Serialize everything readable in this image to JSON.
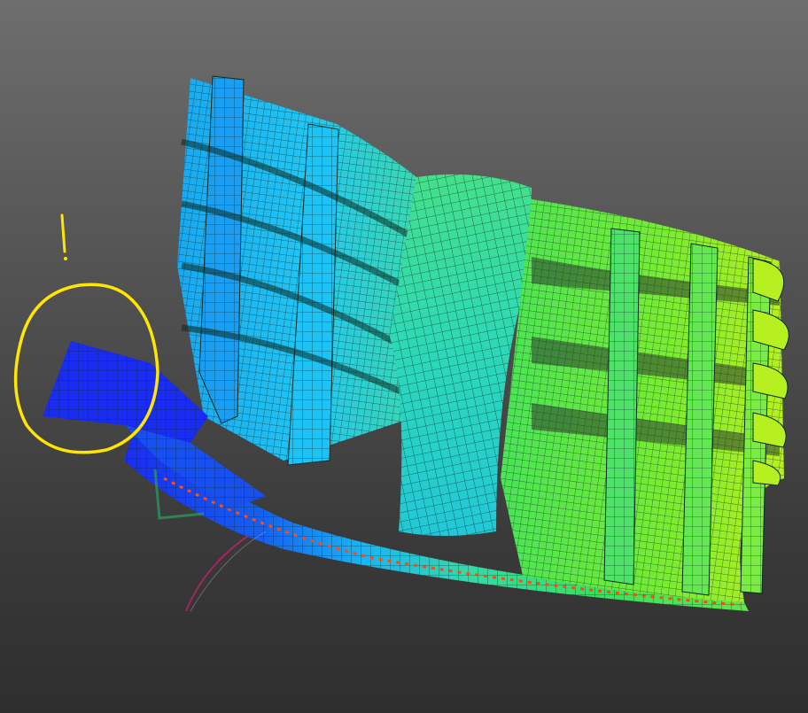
{
  "scene": {
    "description_kind": "fea-mesh-render",
    "colors": {
      "background_top": "#6e6e6e",
      "background_bottom": "#2e2e2e",
      "mesh_line": "#0b2a22",
      "annotation": "#ffe600",
      "dark_blue": "#1a2cf0",
      "blue": "#1560f0",
      "light_blue": "#19b4f5",
      "cyan": "#22d6d0",
      "teal": "#36d9a8",
      "green": "#38e060",
      "lime": "#8af028",
      "yellow_green": "#c8f020",
      "orange_red": "#ff4a10"
    }
  },
  "annotation": {
    "circle_icon": "hand-drawn-circle",
    "mark_icon": "exclamation-mark"
  }
}
